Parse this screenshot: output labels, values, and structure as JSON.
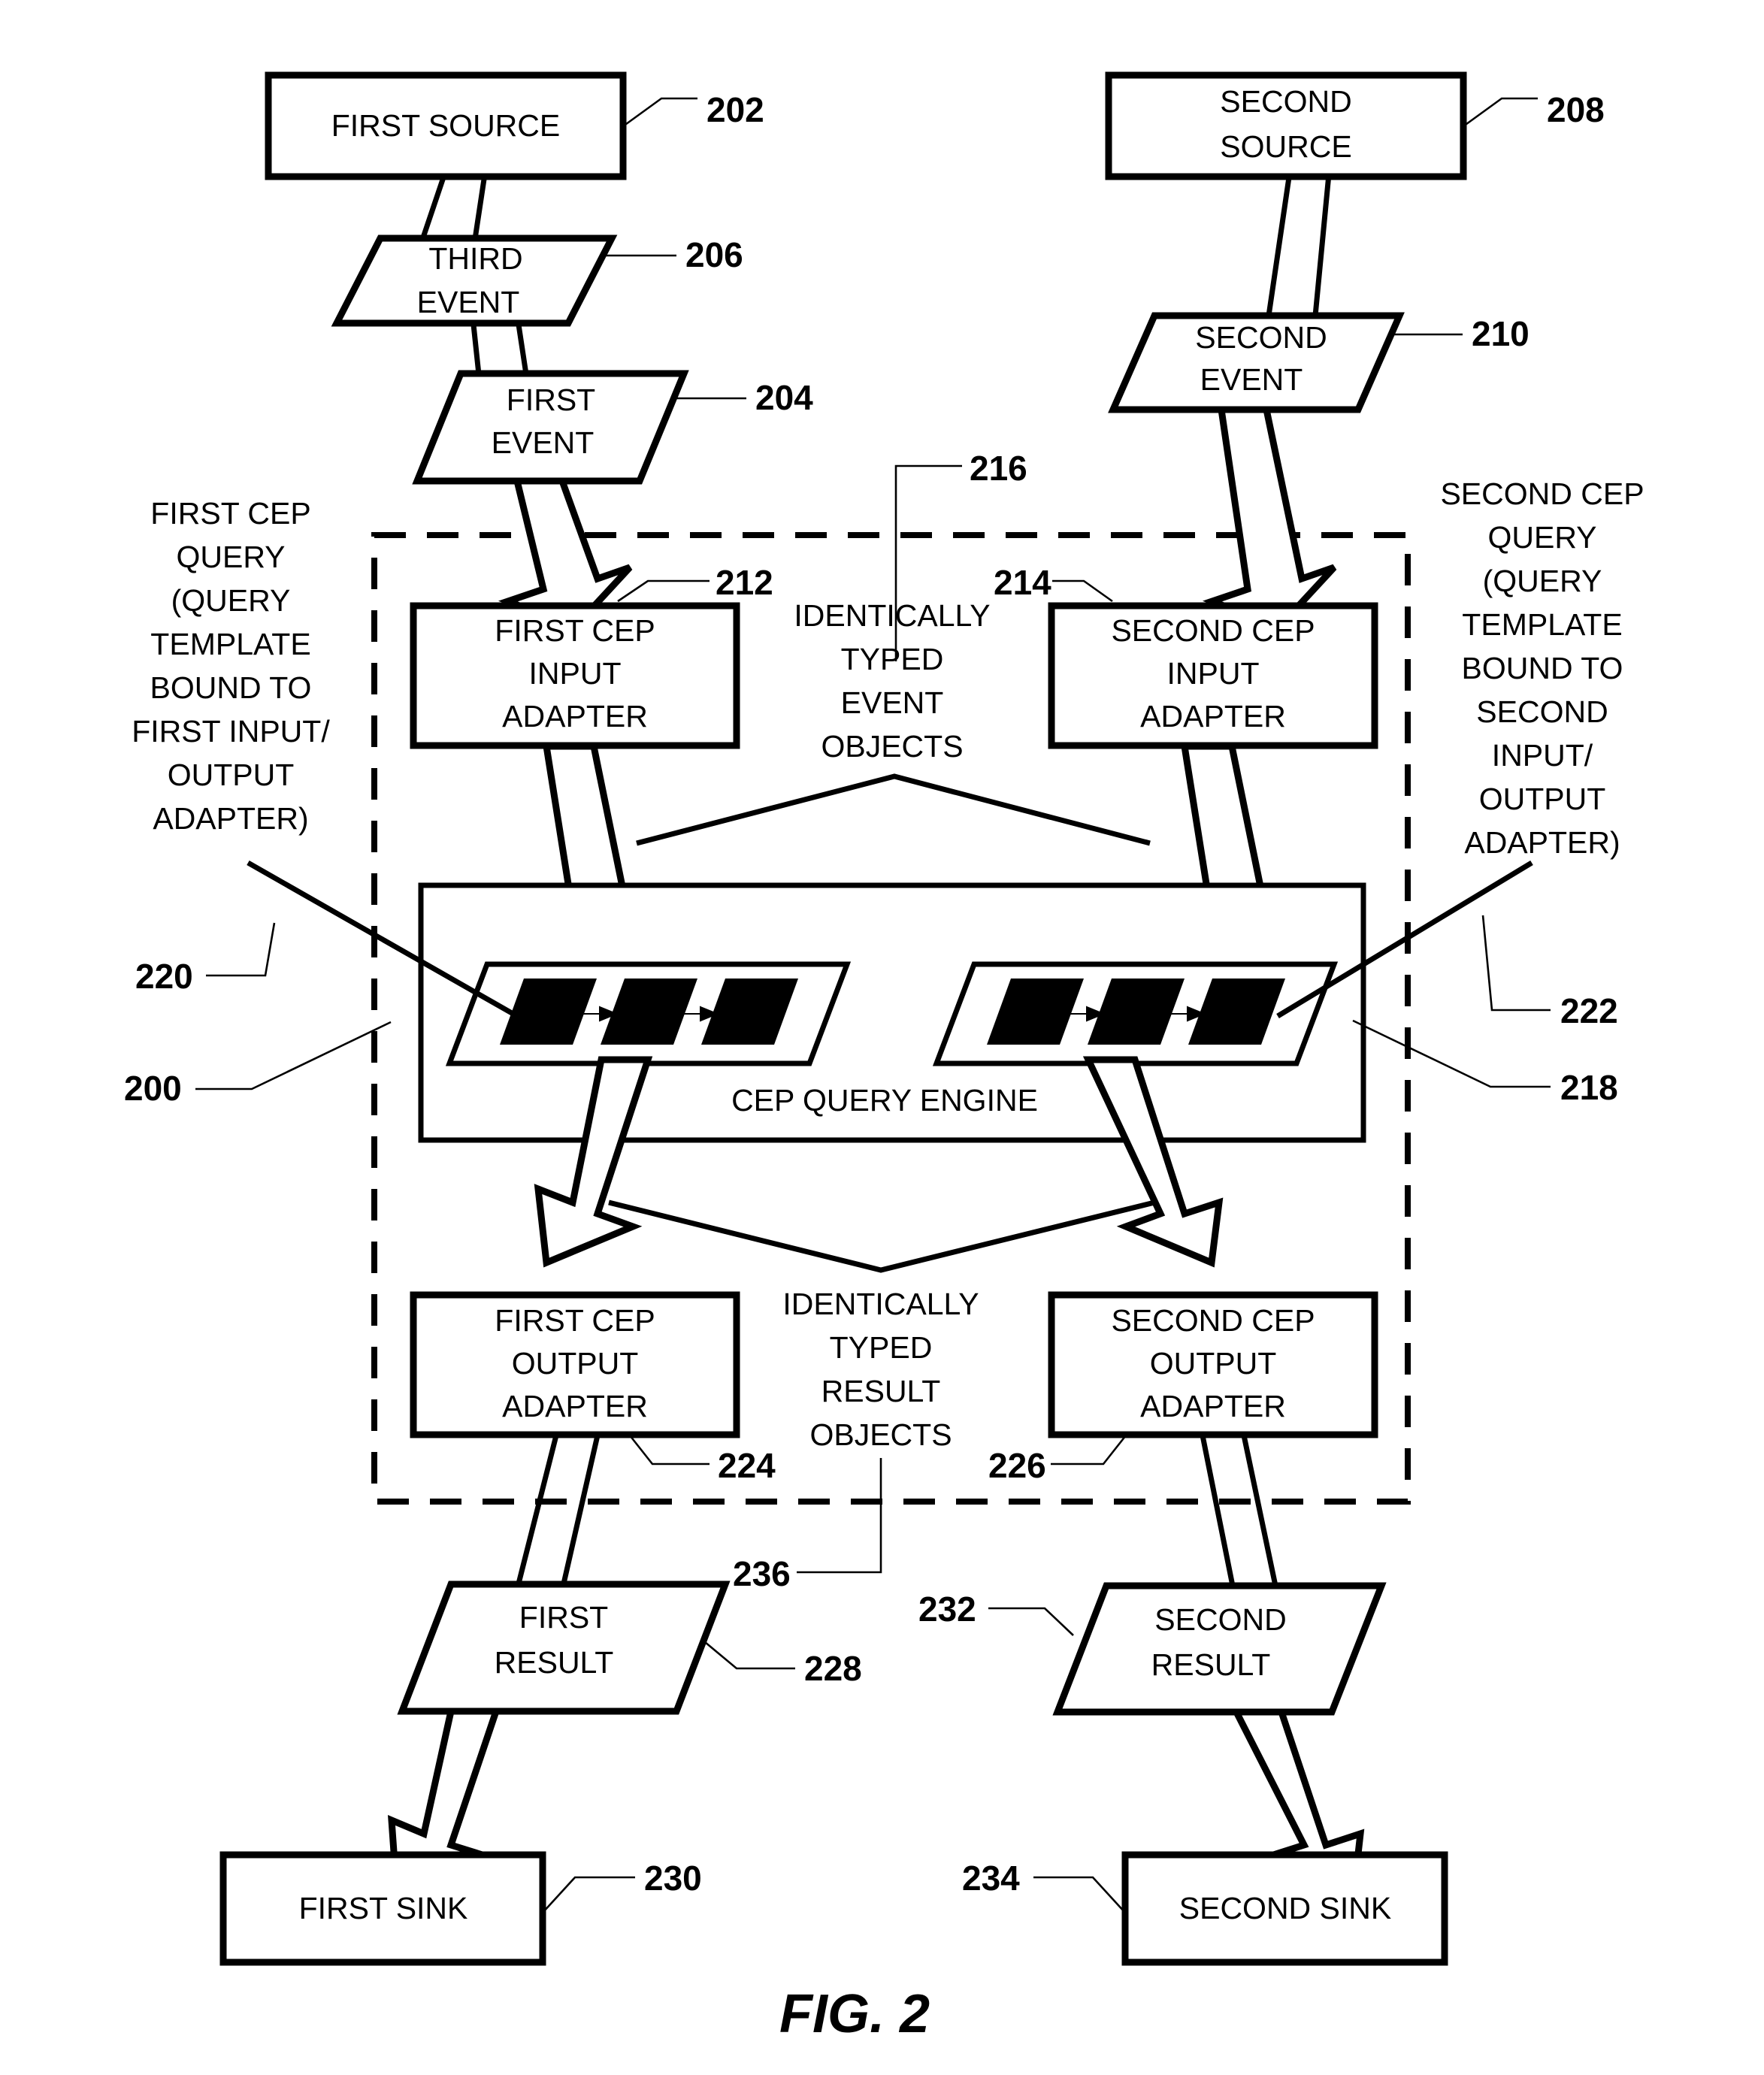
{
  "figure": {
    "caption": "FIG. 2",
    "system_ref": "200"
  },
  "nodes": {
    "first_source": {
      "label": "FIRST SOURCE",
      "ref": "202"
    },
    "second_source": {
      "label_line1": "SECOND",
      "label_line2": "SOURCE",
      "ref": "208"
    },
    "third_event": {
      "label_line1": "THIRD",
      "label_line2": "EVENT",
      "ref": "206"
    },
    "first_event": {
      "label_line1": "FIRST",
      "label_line2": "EVENT",
      "ref": "204"
    },
    "second_event": {
      "label_line1": "SECOND",
      "label_line2": "EVENT",
      "ref": "210"
    },
    "first_cep_input_adapter": {
      "line1": "FIRST CEP",
      "line2": "INPUT",
      "line3": "ADAPTER",
      "ref": "212"
    },
    "second_cep_input_adapter": {
      "line1": "SECOND CEP",
      "line2": "INPUT",
      "line3": "ADAPTER",
      "ref": "214"
    },
    "cep_query_engine": {
      "label": "CEP QUERY ENGINE",
      "ref": "218"
    },
    "first_cep_output_adapter": {
      "line1": "FIRST CEP",
      "line2": "OUTPUT",
      "line3": "ADAPTER",
      "ref": "224"
    },
    "second_cep_output_adapter": {
      "line1": "SECOND CEP",
      "line2": "OUTPUT",
      "line3": "ADAPTER",
      "ref": "226"
    },
    "first_result": {
      "label_line1": "FIRST",
      "label_line2": "RESULT",
      "ref": "228"
    },
    "second_result": {
      "label_line1": "SECOND",
      "label_line2": "RESULT",
      "ref": "232"
    },
    "first_sink": {
      "label": "FIRST SINK",
      "ref": "230"
    },
    "second_sink": {
      "label": "SECOND SINK",
      "ref": "234"
    }
  },
  "annotations": {
    "first_cep_query": {
      "ref": "220",
      "lines": [
        "FIRST CEP",
        "QUERY",
        "(QUERY",
        "TEMPLATE",
        "BOUND TO",
        "FIRST INPUT/",
        "OUTPUT",
        "ADAPTER)"
      ]
    },
    "second_cep_query": {
      "ref": "222",
      "lines": [
        "SECOND CEP",
        "QUERY",
        "(QUERY",
        "TEMPLATE",
        "BOUND TO",
        "SECOND",
        "INPUT/",
        "OUTPUT",
        "ADAPTER)"
      ]
    },
    "identically_typed_event_objects": {
      "ref": "216",
      "lines": [
        "IDENTICALLY",
        "TYPED",
        "EVENT",
        "OBJECTS"
      ]
    },
    "identically_typed_result_objects": {
      "ref": "236",
      "lines": [
        "IDENTICALLY",
        "TYPED",
        "RESULT",
        "OBJECTS"
      ]
    }
  },
  "colors": {
    "stroke": "#000000",
    "fill": "#ffffff",
    "block": "#000000"
  }
}
